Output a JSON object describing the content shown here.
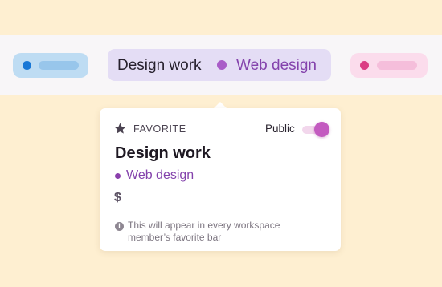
{
  "favorites_bar": {
    "items": [
      {
        "color": "#1877D6"
      },
      {
        "name": "Design work",
        "tag": "Web design",
        "color": "#A95CC8",
        "active": true
      },
      {
        "color": "#DB3D84"
      }
    ]
  },
  "popover": {
    "icon": "star-icon",
    "section_label": "FAVORITE",
    "public_label": "Public",
    "public_enabled": true,
    "title": "Design work",
    "tag": "Web design",
    "tag_color": "#8A40AC",
    "currency_icon": "dollar-icon",
    "currency_symbol": "$",
    "info_icon": "info-icon",
    "note": "This will appear in every workspace member’s favorite bar"
  }
}
